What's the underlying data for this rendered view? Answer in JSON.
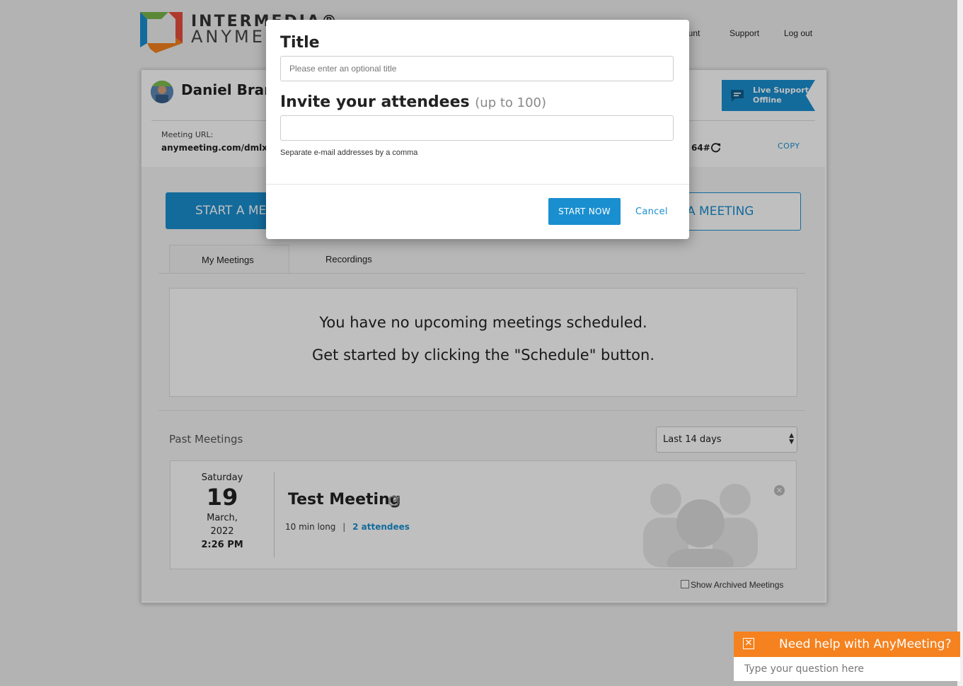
{
  "logo": {
    "line1": "INTERMEDIA®",
    "line2": "ANYMEETING"
  },
  "topnav": {
    "account": "Account",
    "support": "Support",
    "logout": "Log out"
  },
  "user": {
    "name": "Daniel Bramley"
  },
  "live_support": {
    "line1": "Live Support",
    "line2": "Offline"
  },
  "meeting_url": {
    "label": "Meeting URL:",
    "value": "anymeeting.com/dmlxs",
    "pin": "64#",
    "copy": "COPY"
  },
  "actions": {
    "start": "START A MEETING",
    "schedule": "A MEETING"
  },
  "tabs": [
    {
      "label": "My Meetings"
    },
    {
      "label": "Recordings"
    }
  ],
  "empty": {
    "line1": "You have no upcoming meetings scheduled.",
    "line2": "Get started by clicking the \"Schedule\" button."
  },
  "past": {
    "label": "Past Meetings",
    "filter": "Last 14 days"
  },
  "meeting": {
    "weekday": "Saturday",
    "day": "19",
    "month": "March,",
    "year": "2022",
    "time": "2:26 PM",
    "title": "Test Meeting",
    "duration": "10 min long",
    "separator": "|",
    "attendees": "2 attendees"
  },
  "archived": {
    "label": "Show Archived Meetings"
  },
  "modal": {
    "title_heading": "Title",
    "title_placeholder": "Please enter an optional title",
    "invite_heading": "Invite your attendees",
    "invite_sub": "(up to 100)",
    "invite_value": "",
    "help": "Separate e-mail addresses by a comma",
    "start_now": "START NOW",
    "cancel": "Cancel"
  },
  "chat": {
    "title": "Need help with AnyMeeting?",
    "placeholder": "Type your question here"
  },
  "colors": {
    "accent": "#1a8fd0",
    "chat": "#f5821f"
  }
}
